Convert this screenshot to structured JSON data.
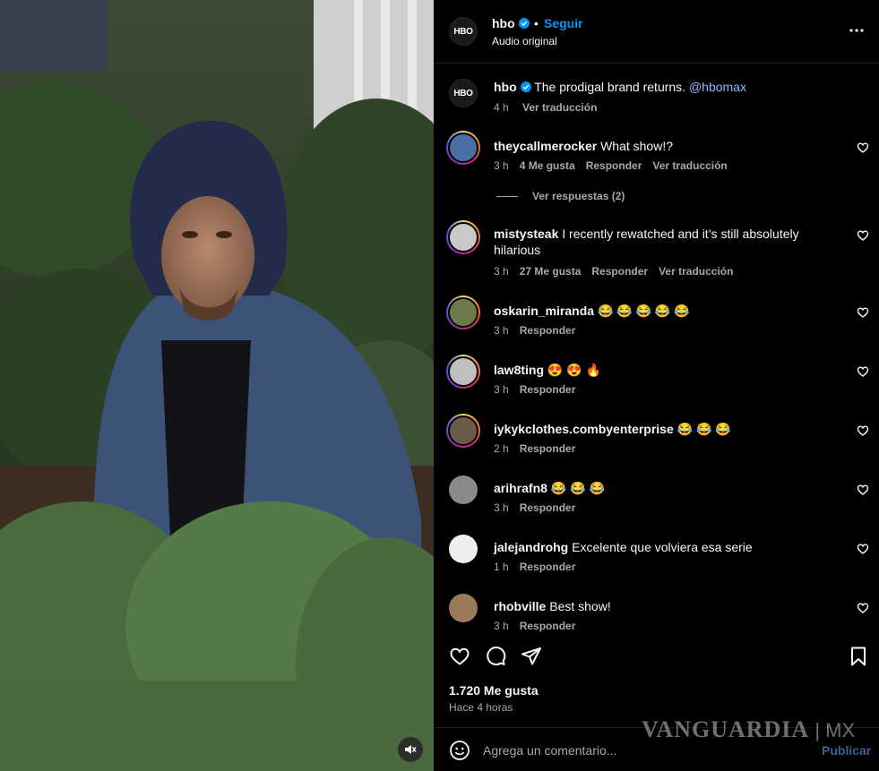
{
  "header": {
    "username": "hbo",
    "avatar_text": "HBO",
    "follow_label": "Seguir",
    "separator": "•",
    "audio": "Audio original"
  },
  "caption": {
    "username": "hbo",
    "text": "The prodigal brand returns.",
    "mention": "@hbomax",
    "time": "4 h",
    "translate": "Ver traducción"
  },
  "comments": [
    {
      "username": "theycallmerocker",
      "text": "What show!?",
      "time": "3 h",
      "likes": "4 Me gusta",
      "reply": "Responder",
      "translate": "Ver traducción"
    },
    {
      "username": "mistysteak",
      "text": "I recently rewatched and it’s still absolutely hilarious",
      "time": "3 h",
      "likes": "27 Me gusta",
      "reply": "Responder",
      "translate": "Ver traducción"
    },
    {
      "username": "oskarin_miranda",
      "text": "😂 😂 😂 😂 😂",
      "time": "3 h",
      "reply": "Responder"
    },
    {
      "username": "law8ting",
      "text": "😍 😍 🔥",
      "time": "3 h",
      "reply": "Responder"
    },
    {
      "username": "iykykclothes.combyenterprise",
      "text": "😂 😂 😂",
      "time": "2 h",
      "reply": "Responder"
    },
    {
      "username": "arihrafn8",
      "text": "😂 😂 😂",
      "time": "3 h",
      "reply": "Responder"
    },
    {
      "username": "jalejandrohg",
      "text": "Excelente que volviera esa serie",
      "time": "1 h",
      "reply": "Responder"
    },
    {
      "username": "rhobville",
      "text": "Best show!",
      "time": "3 h",
      "reply": "Responder"
    }
  ],
  "view_replies": "Ver respuestas (2)",
  "likes_count": "1.720 Me gusta",
  "posted_ago": "Hace 4 horas",
  "composer": {
    "placeholder": "Agrega un comentario...",
    "publish_label": "Publicar"
  },
  "watermark": {
    "brand": "VANGUARDIA",
    "suffix": "MX"
  },
  "colors": {
    "accent": "#0095f6",
    "verified": "#0095f6",
    "muted": "#a8a8a8",
    "background": "#000000"
  },
  "icons": [
    "verified-icon",
    "more-options-icon",
    "heart-icon",
    "comment-icon",
    "share-icon",
    "save-icon",
    "emoji-icon",
    "muted-speaker-icon"
  ]
}
